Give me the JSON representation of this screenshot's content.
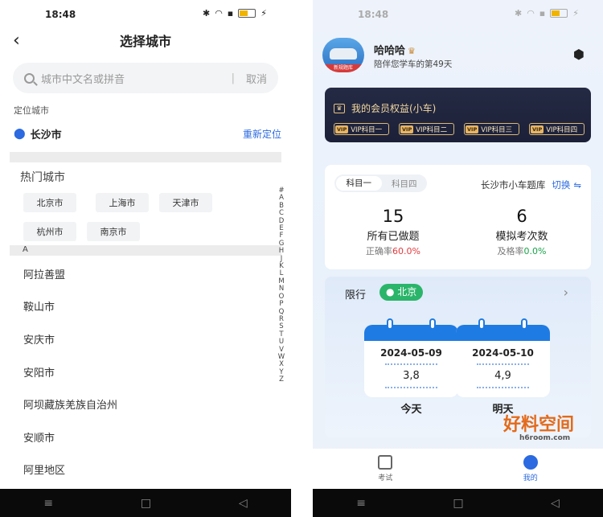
{
  "left": {
    "status": {
      "time": "18:48"
    },
    "title": "选择城市",
    "search": {
      "placeholder": "城市中文名或拼音",
      "cancel": "取消"
    },
    "loc_section": "定位城市",
    "loc_city": "长沙市",
    "relocate": "重新定位",
    "hot_title": "热门城市",
    "hot_cities": [
      "北京市",
      "上海市",
      "天津市",
      "杭州市",
      "南京市"
    ],
    "group_letter": "A",
    "cities": [
      "阿拉善盟",
      "鞍山市",
      "安庆市",
      "安阳市",
      "阿坝藏族羌族自治州",
      "安顺市",
      "阿里地区"
    ],
    "index": [
      "#",
      "A",
      "B",
      "C",
      "D",
      "E",
      "F",
      "G",
      "H",
      "J",
      "K",
      "L",
      "M",
      "N",
      "O",
      "P",
      "Q",
      "R",
      "S",
      "T",
      "U",
      "V",
      "W",
      "X",
      "Y",
      "Z"
    ]
  },
  "right": {
    "status": {
      "time": "18:48"
    },
    "user": {
      "name": "哈哈哈",
      "subtitle": "陪伴您学车的第49天",
      "avatar_label": "新规题库"
    },
    "vip": {
      "title": "我的会员权益(小车)",
      "badges": [
        "VIP科目一",
        "VIP科目二",
        "VIP科目三",
        "VIP科目四"
      ]
    },
    "stats": {
      "tabs": [
        "科目一",
        "科目四"
      ],
      "bank": "长沙市小车题库",
      "switch": "切换",
      "done": {
        "num": "15",
        "label": "所有已做题",
        "sub_prefix": "正确率",
        "sub_value": "60.0%"
      },
      "mock": {
        "num": "6",
        "label": "模拟考次数",
        "sub_prefix": "及格率",
        "sub_value": "0.0%"
      }
    },
    "limit": {
      "title": "限行",
      "city": "北京",
      "days": [
        {
          "date": "2024-05-09",
          "nums": "3,8",
          "label": "今天"
        },
        {
          "date": "2024-05-10",
          "nums": "4,9",
          "label": "明天"
        }
      ]
    },
    "watermark": {
      "main": "好料空间",
      "sub": "h6room.com"
    },
    "tabs": [
      "考试",
      "我的"
    ]
  }
}
